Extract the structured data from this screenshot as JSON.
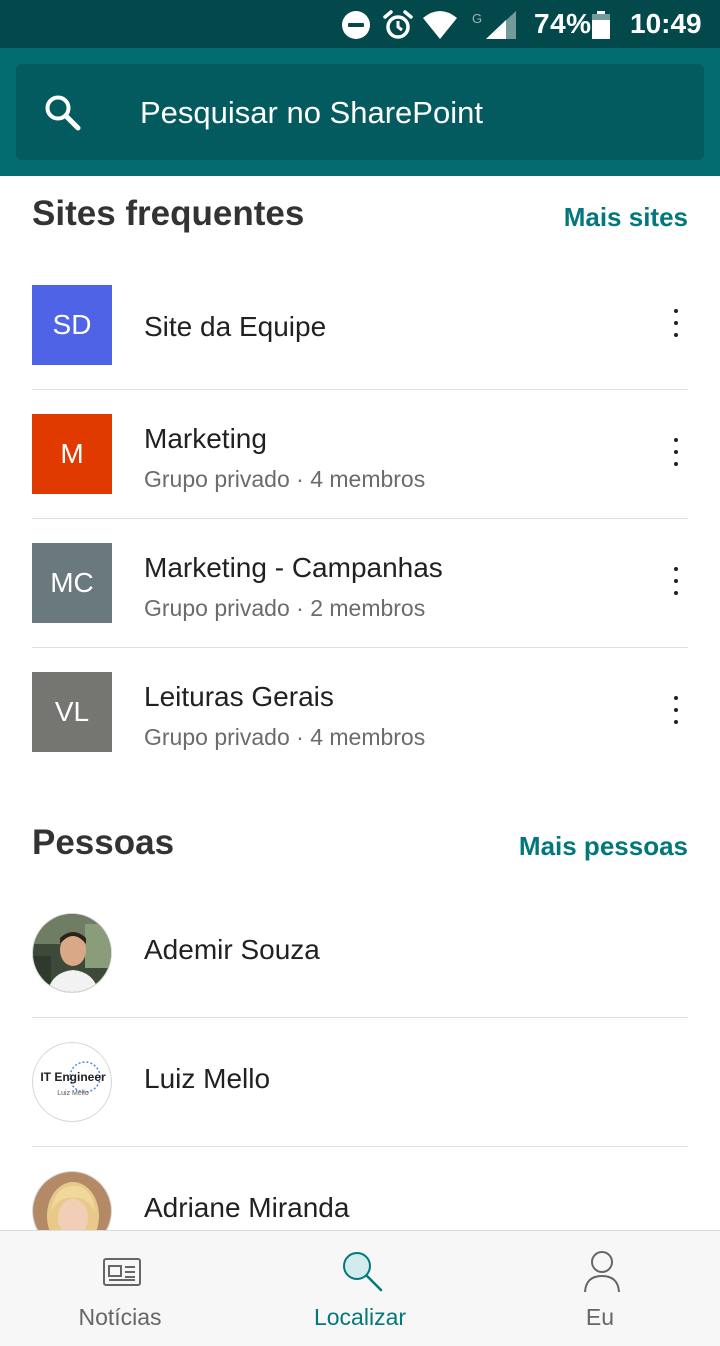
{
  "status_bar": {
    "battery_percent": "74%",
    "time": "10:49",
    "network_label": "G",
    "icons": [
      "do-not-disturb-icon",
      "alarm-icon",
      "wifi-icon",
      "signal-icon",
      "battery-icon"
    ]
  },
  "search": {
    "placeholder": "Pesquisar no SharePoint"
  },
  "frequent_sites": {
    "title": "Sites frequentes",
    "more_link": "Mais sites",
    "items": [
      {
        "initials": "SD",
        "name": "Site da Equipe",
        "subtitle": "",
        "tile_color": "#4f63e7"
      },
      {
        "initials": "M",
        "name": "Marketing",
        "subtitle": "Grupo privado · 4 membros",
        "tile_color": "#e03a00"
      },
      {
        "initials": "MC",
        "name": "Marketing - Campanhas",
        "subtitle": "Grupo privado · 2 membros",
        "tile_color": "#69797e"
      },
      {
        "initials": "VL",
        "name": "Leituras Gerais",
        "subtitle": "Grupo privado · 4 membros",
        "tile_color": "#757572"
      }
    ]
  },
  "people": {
    "title": "Pessoas",
    "more_link": "Mais pessoas",
    "items": [
      {
        "name": "Ademir Souza"
      },
      {
        "name": "Luiz Mello",
        "avatar_text": "IT Engineer",
        "avatar_subtext": "Luiz Mello"
      },
      {
        "name": "Adriane Miranda"
      }
    ]
  },
  "bottom_nav": {
    "items": [
      {
        "label": "Notícias",
        "icon": "news-icon"
      },
      {
        "label": "Localizar",
        "icon": "search-icon",
        "active": true
      },
      {
        "label": "Eu",
        "icon": "person-icon"
      }
    ]
  },
  "colors": {
    "status_bar": "#03494c",
    "app_bar": "#036c70",
    "search_box": "#035b5f",
    "accent": "#03787c"
  }
}
